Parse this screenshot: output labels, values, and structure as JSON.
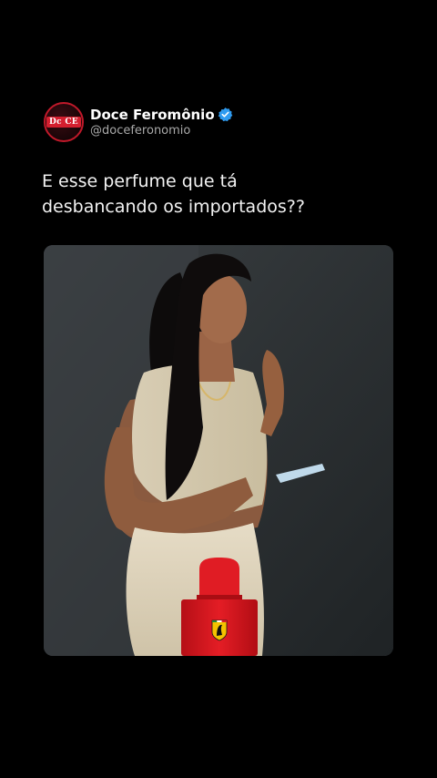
{
  "post": {
    "avatar_text": "Dc CE",
    "display_name": "Doce Feromônio",
    "handle": "@doceferonomio",
    "text": "E esse perfume que tá\ndesbancando os importados??"
  },
  "media": {
    "description_icon": "video-thumbnail",
    "colors": {
      "background": "#2c3033",
      "bottle": "#d8161e",
      "badge": "#f4c200"
    }
  }
}
